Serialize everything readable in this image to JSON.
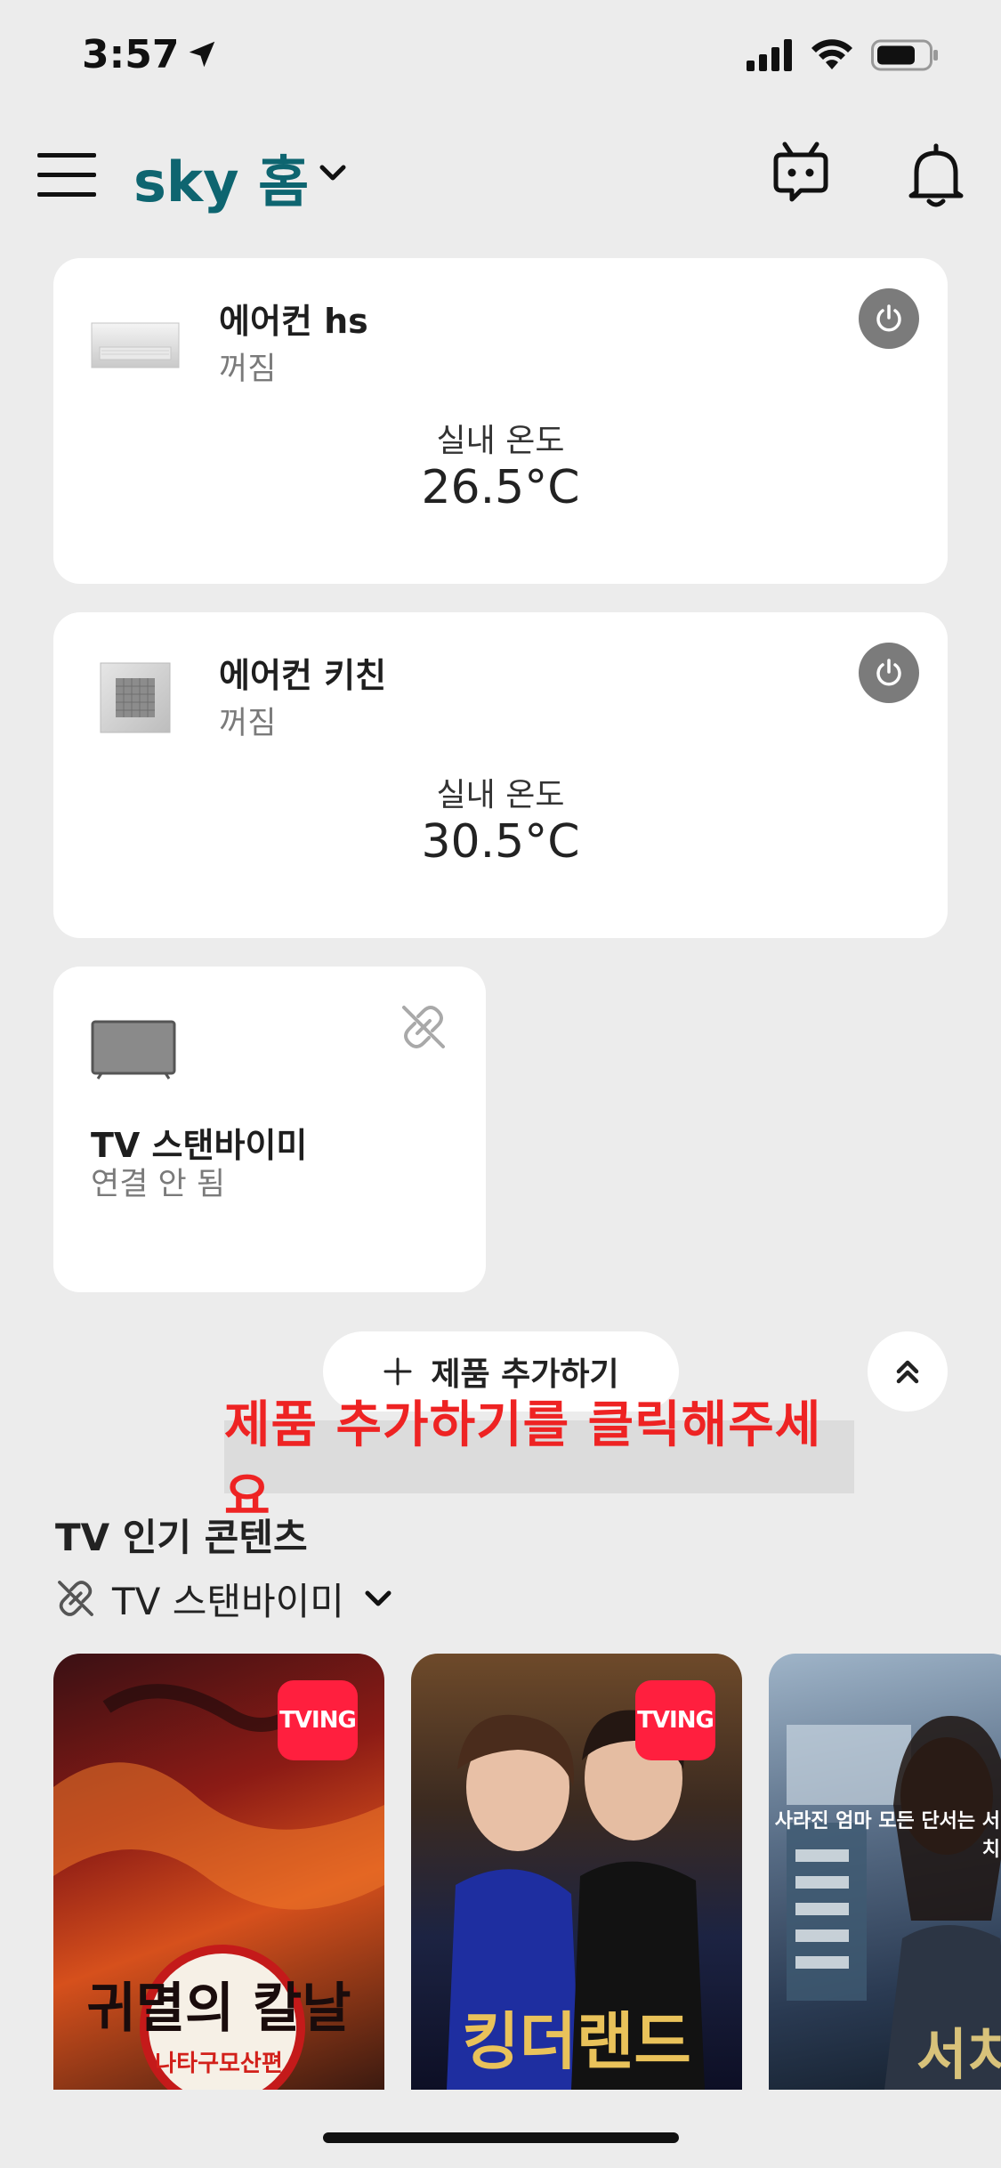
{
  "status_bar": {
    "time": "3:57"
  },
  "header": {
    "home_name": "sky 홈"
  },
  "devices": [
    {
      "name": "에어컨 hs",
      "status": "꺼짐",
      "temp_label": "실내 온도",
      "temp_value": "26.5°C"
    },
    {
      "name": "에어컨 키친",
      "status": "꺼짐",
      "temp_label": "실내 온도",
      "temp_value": "30.5°C"
    },
    {
      "name": "TV 스탠바이미",
      "status": "연결 안 됨"
    }
  ],
  "add_product": {
    "label": "제품 추가하기"
  },
  "hint": {
    "text": "제품 추가하기를 클릭해주세요"
  },
  "tv_section": {
    "title": "TV 인기 콘텐츠",
    "selected_tv": "TV 스탠바이미",
    "posters": [
      {
        "badge": "TVING",
        "title": "귀멸의 칼날",
        "subtitle": "나타구모산편"
      },
      {
        "badge": "TVING",
        "title": "킹더랜드"
      },
      {
        "title": "서치",
        "caption": "사라진 엄마 모든 단서는 서치"
      }
    ]
  },
  "colors": {
    "brand": "#0e6570",
    "hint_red": "#ee2323",
    "tving": "#ff1f3e",
    "power_gray": "#7b7b7b"
  }
}
